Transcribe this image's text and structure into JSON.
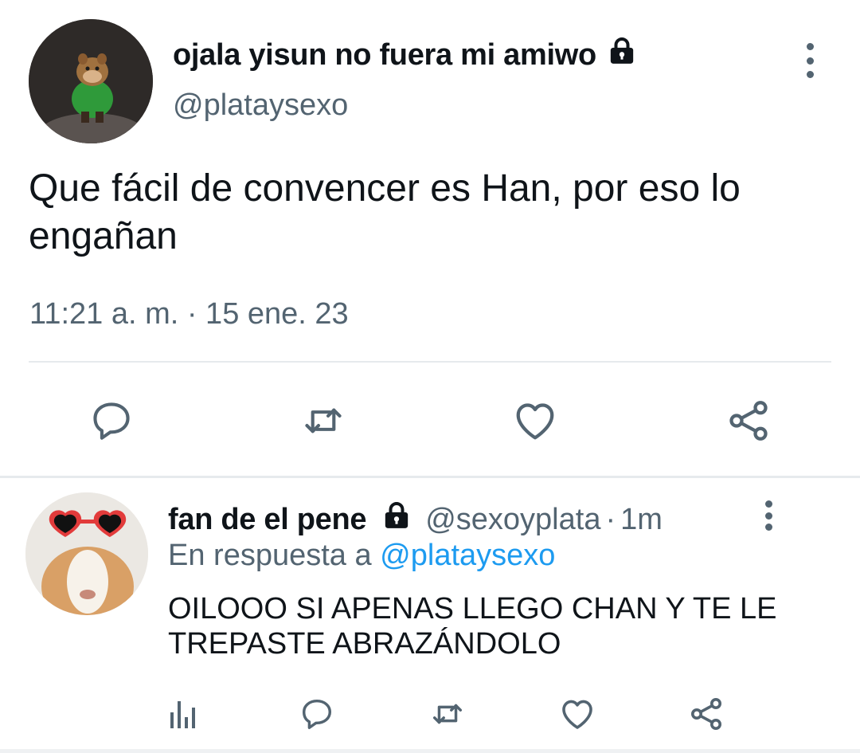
{
  "main_tweet": {
    "display_name": "ojala yisun no fuera mi amiwo",
    "handle": "@plataysexo",
    "text": "Que fácil de convencer es Han, por eso lo engañan",
    "timestamp": "11:21 a. m. · 15 ene. 23",
    "actions": [
      "reply-icon",
      "retweet-icon",
      "like-icon",
      "share-icon"
    ]
  },
  "reply_tweet": {
    "display_name": "fan de el pene",
    "handle": "@sexoyplata",
    "separator": "·",
    "time": "1m",
    "replying_to_label": "En respuesta a",
    "replying_to_handle": "@plataysexo",
    "text": "OILOOO SI APENAS LLEGO CHAN Y TE LE TREPASTE ABRAZÁNDOLO",
    "actions": [
      "analytics-icon",
      "reply-icon",
      "retweet-icon",
      "like-icon",
      "share-icon"
    ]
  },
  "colors": {
    "text_primary": "#0f1419",
    "text_secondary": "#536471",
    "mention": "#1d9bf0",
    "divider": "#e6eaed"
  }
}
